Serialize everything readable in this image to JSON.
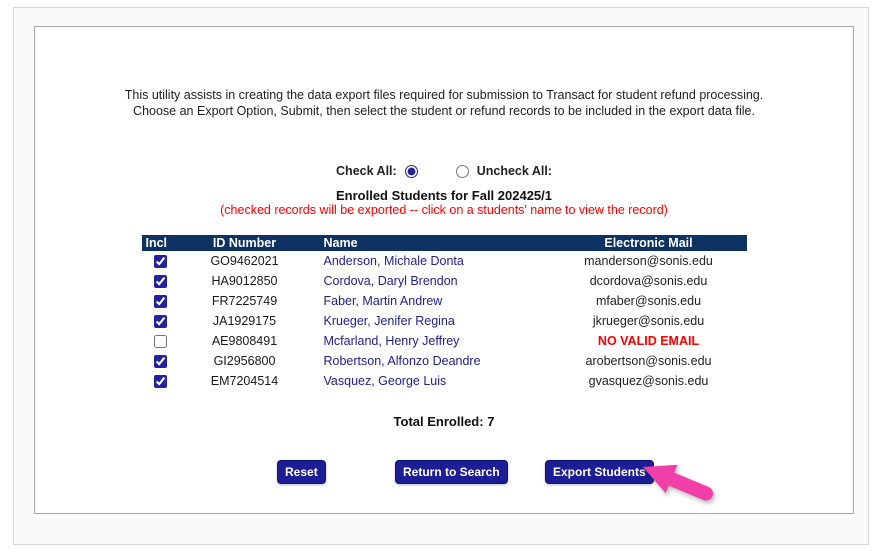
{
  "instructions": {
    "line1": "This utility assists in creating the data export files required for submission to Transact for student refund processing.",
    "line2": "Choose an Export Option, Submit, then select the student or refund records to be included in the export data file."
  },
  "controls": {
    "check_all_label": "Check All:",
    "uncheck_all_label": "Uncheck All:",
    "check_all_selected": true,
    "uncheck_all_selected": false
  },
  "list": {
    "title": "Enrolled Students for Fall 202425/1",
    "note": "(checked records will be exported -- click on a students' name to view the record)",
    "total_label": "Total Enrolled: 7"
  },
  "table": {
    "headers": [
      "Incl",
      "ID Number",
      "Name",
      "Electronic Mail"
    ],
    "rows": [
      {
        "checked": true,
        "id": "GO9462021",
        "name": "Anderson, Michale Donta",
        "email": "manderson@sonis.edu",
        "email_valid": true
      },
      {
        "checked": true,
        "id": "HA9012850",
        "name": "Cordova, Daryl Brendon",
        "email": "dcordova@sonis.edu",
        "email_valid": true
      },
      {
        "checked": true,
        "id": "FR7225749",
        "name": "Faber, Martin Andrew",
        "email": "mfaber@sonis.edu",
        "email_valid": true
      },
      {
        "checked": true,
        "id": "JA1929175",
        "name": "Krueger, Jenifer Regina",
        "email": "jkrueger@sonis.edu",
        "email_valid": true
      },
      {
        "checked": false,
        "id": "AE9808491",
        "name": "Mcfarland, Henry Jeffrey",
        "email": "NO VALID EMAIL",
        "email_valid": false
      },
      {
        "checked": true,
        "id": "GI2956800",
        "name": "Robertson, Alfonzo Deandre",
        "email": "arobertson@sonis.edu",
        "email_valid": true
      },
      {
        "checked": true,
        "id": "EM7204514",
        "name": "Vasquez, George Luis",
        "email": "gvasquez@sonis.edu",
        "email_valid": true
      }
    ]
  },
  "buttons": {
    "reset": "Reset",
    "return": "Return to Search",
    "export": "Export Students"
  },
  "colors": {
    "header_bg": "#0e3163",
    "button_bg": "#1d1d96",
    "link": "#21218f",
    "alert": "#ff0000",
    "arrow": "#f23fa7",
    "accent": "#23239f"
  }
}
